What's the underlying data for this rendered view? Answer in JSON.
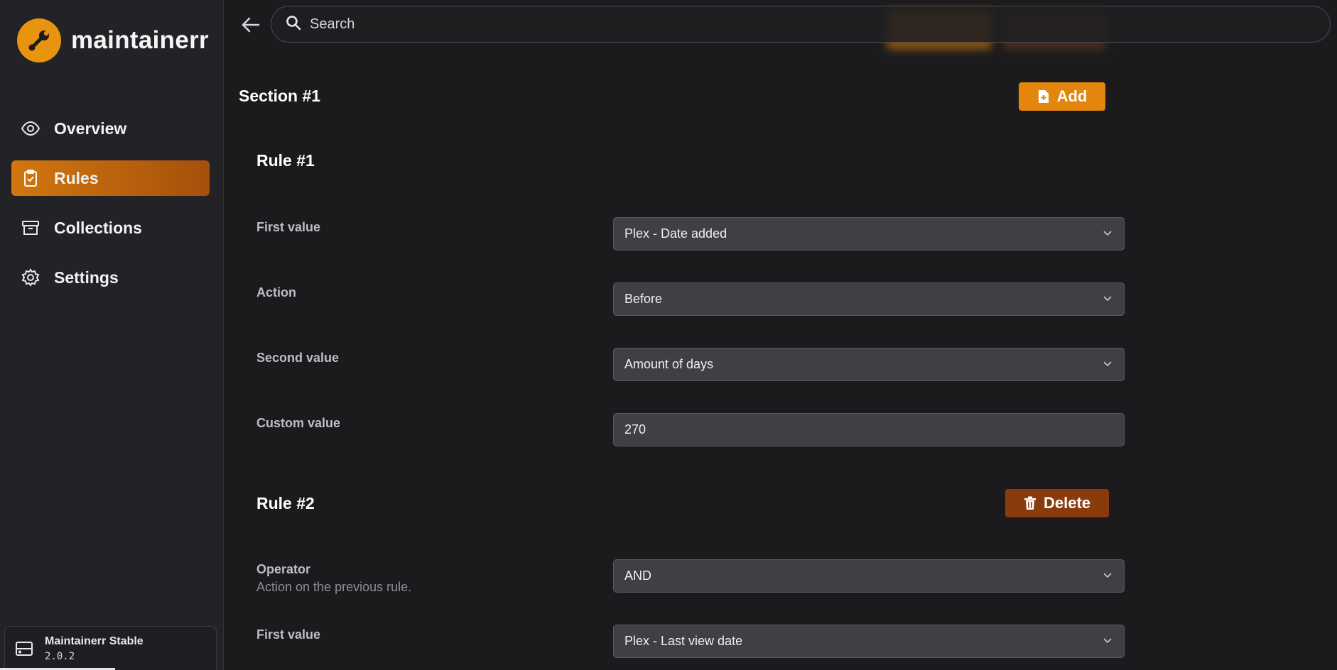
{
  "app": {
    "name": "maintainerr"
  },
  "sidebar": {
    "items": [
      {
        "label": "Overview",
        "icon": "eye-icon",
        "active": false
      },
      {
        "label": "Rules",
        "icon": "clipboard-check-icon",
        "active": true
      },
      {
        "label": "Collections",
        "icon": "archive-box-icon",
        "active": false
      },
      {
        "label": "Settings",
        "icon": "gear-icon",
        "active": false
      }
    ],
    "version": {
      "name": "Maintainerr Stable",
      "number": "2.0.2",
      "icon": "server-icon"
    }
  },
  "topbar": {
    "search_placeholder": "Search"
  },
  "section": {
    "title": "Section #1",
    "add_label": "Add"
  },
  "rules": [
    {
      "title": "Rule #1",
      "fields": [
        {
          "label": "First value",
          "type": "select",
          "value": "Plex - Date added"
        },
        {
          "label": "Action",
          "type": "select",
          "value": "Before"
        },
        {
          "label": "Second value",
          "type": "select",
          "value": "Amount of days"
        },
        {
          "label": "Custom value",
          "type": "input",
          "value": "270"
        }
      ]
    },
    {
      "title": "Rule #2",
      "delete_label": "Delete",
      "fields": [
        {
          "label": "Operator",
          "description": "Action on the previous rule.",
          "type": "select",
          "value": "AND"
        },
        {
          "label": "First value",
          "type": "select",
          "value": "Plex - Last view date"
        }
      ]
    }
  ],
  "colors": {
    "accent": "#e4860d",
    "danger": "#8a3b0c",
    "background": "#1b1b1d",
    "sidebar": "#232327"
  }
}
